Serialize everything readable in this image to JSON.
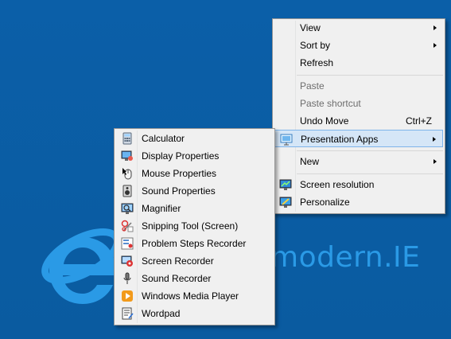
{
  "brand": {
    "text": "modern.IE",
    "logo_icon": "internet-explorer-logo"
  },
  "context_menu": {
    "items": [
      {
        "label": "View",
        "submenu": true
      },
      {
        "label": "Sort by",
        "submenu": true
      },
      {
        "label": "Refresh"
      },
      {
        "label": "Paste",
        "disabled": true
      },
      {
        "label": "Paste shortcut",
        "disabled": true
      },
      {
        "label": "Undo Move",
        "shortcut": "Ctrl+Z"
      },
      {
        "label": "Presentation Apps",
        "submenu": true,
        "icon": "presentation-icon",
        "highlighted": true
      },
      {
        "label": "New",
        "submenu": true
      },
      {
        "label": "Screen resolution",
        "icon": "screen-resolution-icon"
      },
      {
        "label": "Personalize",
        "icon": "personalize-icon"
      }
    ]
  },
  "submenu": {
    "items": [
      {
        "label": "Calculator",
        "icon": "calculator-icon"
      },
      {
        "label": "Display Properties",
        "icon": "display-properties-icon"
      },
      {
        "label": "Mouse Properties",
        "icon": "mouse-icon"
      },
      {
        "label": "Sound Properties",
        "icon": "speaker-icon"
      },
      {
        "label": "Magnifier",
        "icon": "magnifier-icon"
      },
      {
        "label": "Snipping Tool (Screen)",
        "icon": "snipping-tool-icon"
      },
      {
        "label": "Problem Steps Recorder",
        "icon": "steps-recorder-icon"
      },
      {
        "label": "Screen Recorder",
        "icon": "screen-recorder-icon"
      },
      {
        "label": "Sound Recorder",
        "icon": "microphone-icon"
      },
      {
        "label": "Windows Media Player",
        "icon": "media-player-icon"
      },
      {
        "label": "Wordpad",
        "icon": "wordpad-icon"
      }
    ]
  }
}
